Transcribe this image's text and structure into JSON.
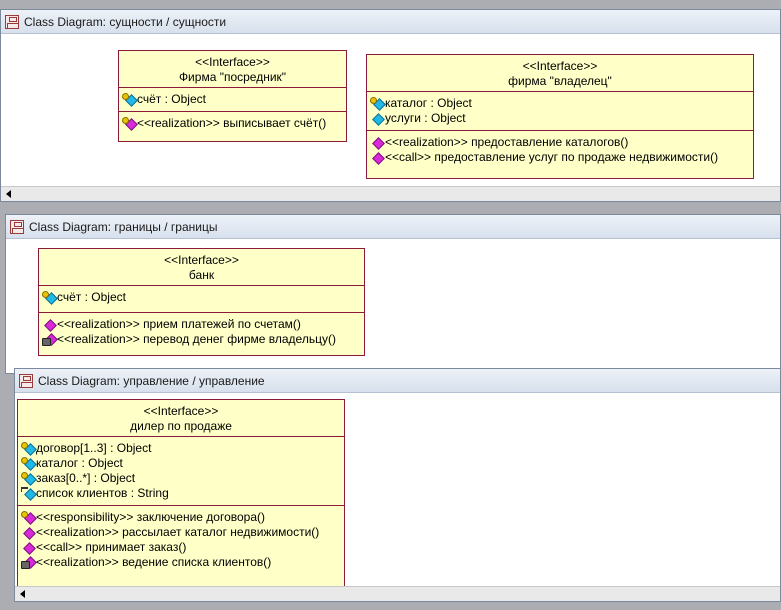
{
  "windows": [
    {
      "title": "Class Diagram: сущности / сущности",
      "classes": [
        {
          "stereotype": "<<Interface>>",
          "name": "Фирма \"посредник\"",
          "attributes": [
            {
              "icon": "attribute-key-icon",
              "text": "счёт : Object"
            }
          ],
          "operations": [
            {
              "icon": "operation-key-icon",
              "text": "<<realization>> выписывает счёт()"
            }
          ]
        },
        {
          "stereotype": "<<Interface>>",
          "name": "фирма \"владелец\"",
          "attributes": [
            {
              "icon": "attribute-key-icon",
              "text": "каталог : Object"
            },
            {
              "icon": "attribute-icon",
              "text": "услуги : Object"
            }
          ],
          "operations": [
            {
              "icon": "operation-icon",
              "text": "<<realization>> предоставление каталогов()"
            },
            {
              "icon": "operation-icon",
              "text": "<<call>> предоставление услуг по продаже недвижимости()"
            }
          ]
        }
      ]
    },
    {
      "title": "Class Diagram: границы / границы",
      "classes": [
        {
          "stereotype": "<<Interface>>",
          "name": "банк",
          "attributes": [
            {
              "icon": "attribute-key-icon",
              "text": "счёт : Object"
            }
          ],
          "operations": [
            {
              "icon": "operation-icon",
              "text": "<<realization>> прием платежей по счетам()"
            },
            {
              "icon": "operation-lock-icon",
              "text": "<<realization>> перевод денег фирме владельцу()"
            }
          ]
        }
      ]
    },
    {
      "title": "Class Diagram: управление / управление",
      "classes": [
        {
          "stereotype": "<<Interface>>",
          "name": "дилер по продаже",
          "attributes": [
            {
              "icon": "attribute-key-icon",
              "text": "договор[1..3] : Object"
            },
            {
              "icon": "attribute-key-icon",
              "text": "каталог : Object"
            },
            {
              "icon": "attribute-key-icon",
              "text": "заказ[0..*] : Object"
            },
            {
              "icon": "attribute-implementation-icon",
              "text": "список клиентов : String"
            }
          ],
          "operations": [
            {
              "icon": "operation-key-icon",
              "text": "<<responsibility>> заключение договора()"
            },
            {
              "icon": "operation-icon",
              "text": "<<realization>> рассылает каталог недвижимости()"
            },
            {
              "icon": "operation-icon",
              "text": "<<call>> принимает заказ()"
            },
            {
              "icon": "operation-lock-icon",
              "text": "<<realization>> ведение списка клиентов()"
            }
          ]
        }
      ]
    }
  ],
  "colors": {
    "class_fill": "#ffffc8",
    "class_border": "#8b1a3a",
    "attribute_icon": "#22b8e6",
    "operation_icon": "#d82ad8"
  }
}
